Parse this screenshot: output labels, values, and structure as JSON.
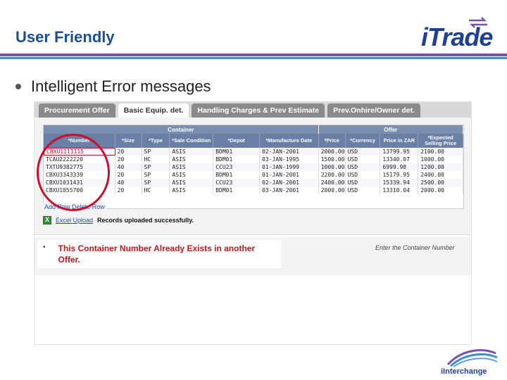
{
  "slide": {
    "title": "User Friendly",
    "bullet": "Intelligent Error messages"
  },
  "logo": {
    "text_i": "i",
    "text_rest": "Trade"
  },
  "footer_logo": {
    "text": "iInterchange"
  },
  "tabs": [
    {
      "label": "Procurement Offer",
      "active": false
    },
    {
      "label": "Basic Equip. det.",
      "active": true
    },
    {
      "label": "Handling Charges & Prev Estimate",
      "active": false
    },
    {
      "label": "Prev.Onhire/Owner det.",
      "active": false
    }
  ],
  "grid": {
    "groups": {
      "container": "Container",
      "offer": "Offer"
    },
    "headers": [
      "*Number",
      "*Size",
      "*Type",
      "*Sale Condition",
      "*Depot",
      "*Manufacture Date",
      "*Price",
      "*Currency",
      "Price in ZAR",
      "*Expected Selling Price"
    ],
    "rows": [
      [
        "CBXU1111115",
        "20",
        "SP",
        "ASIS",
        "BDM01",
        "02-JAN-2001",
        "2000.00",
        "USD",
        "13799.95",
        "2100.00"
      ],
      [
        "TCAU2222220",
        "20",
        "HC",
        "ASIS",
        "BDM01",
        "03-JAN-1995",
        "1500.00",
        "USD",
        "13340.07",
        "1000.00"
      ],
      [
        "TXTU9382775",
        "40",
        "SP",
        "ASIS",
        "CCU23",
        "01-JAN-1999",
        "1000.00",
        "USD",
        "6999.98",
        "1200.00"
      ],
      [
        "CBXU3343339",
        "20",
        "SP",
        "ASIS",
        "BDM01",
        "01-JAN-2001",
        "2200.00",
        "USD",
        "15179.95",
        "2400.00"
      ],
      [
        "CBXU1031431",
        "40",
        "SP",
        "ASIS",
        "CCU23",
        "02-JAN-2001",
        "2400.00",
        "USD",
        "15339.94",
        "2500.00"
      ],
      [
        "CBXU1055700",
        "20",
        "HC",
        "ASIS",
        "BDM01",
        "03-JAN-2001",
        "2000.00",
        "USD",
        "13310.04",
        "2000.00"
      ]
    ]
  },
  "links": {
    "add_row": "Add Row",
    "delete_row": "Delete Row"
  },
  "upload": {
    "link": "Excel Upload",
    "message_prefix": "Records uploaded",
    "message_strong": "successfully."
  },
  "error": {
    "bullet": "•",
    "message": "This Container Number Already Exists in another Offer."
  },
  "hint": "Enter the Container Number",
  "colors": {
    "accent": "#7a52a8",
    "brand": "#1d3f95",
    "error": "#c0151f",
    "highlight": "#c8102e"
  }
}
